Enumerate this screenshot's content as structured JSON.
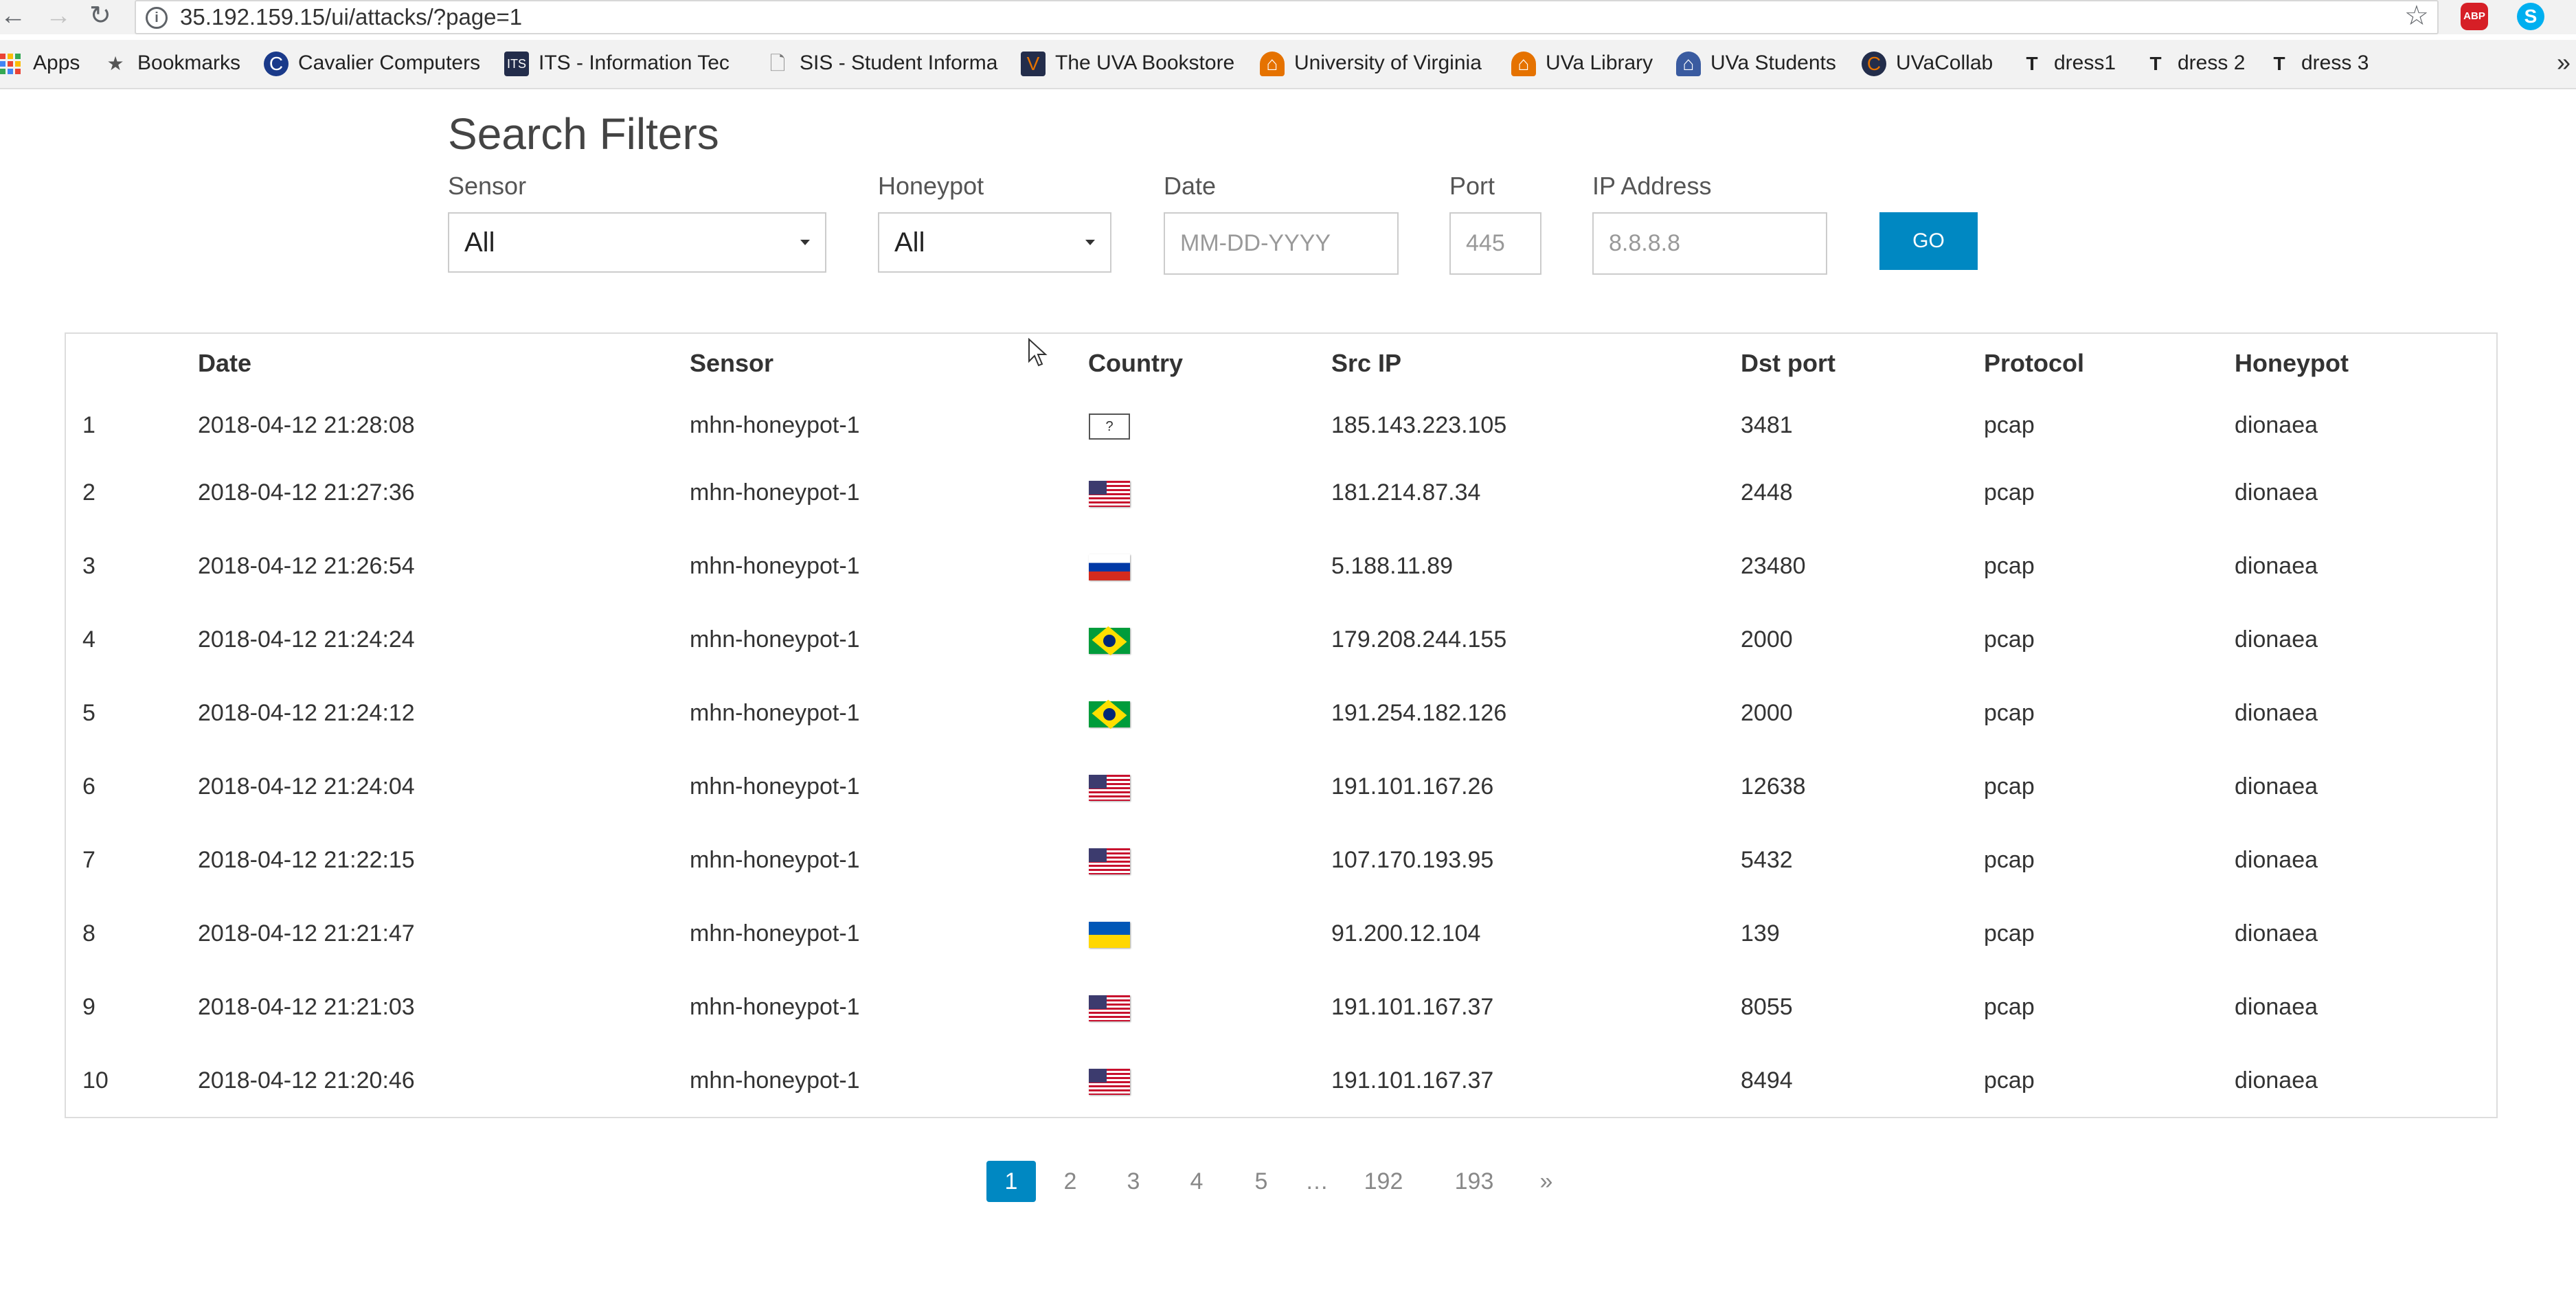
{
  "browser": {
    "url": "35.192.159.15/ui/attacks/?page=1",
    "bookmarks": [
      {
        "label": "Apps",
        "icon": "apps-grid-icon"
      },
      {
        "label": "Bookmarks",
        "icon": "star-icon"
      },
      {
        "label": "Cavalier Computers",
        "icon": "cavalier-icon"
      },
      {
        "label": "ITS - Information Tec",
        "icon": "its-icon"
      },
      {
        "label": "SIS - Student Informa",
        "icon": "page-icon"
      },
      {
        "label": "The UVA Bookstore",
        "icon": "bookstore-icon"
      },
      {
        "label": "University of Virginia",
        "icon": "uva-rotunda-icon"
      },
      {
        "label": "UVa Library",
        "icon": "uva-rotunda-icon"
      },
      {
        "label": "UVa Students",
        "icon": "uva-rotunda-icon"
      },
      {
        "label": "UVaCollab",
        "icon": "collab-icon"
      },
      {
        "label": "dress1",
        "icon": "t-icon"
      },
      {
        "label": "dress 2",
        "icon": "t-icon"
      },
      {
        "label": "dress 3",
        "icon": "t-icon"
      }
    ]
  },
  "filters": {
    "title": "Search Filters",
    "sensor": {
      "label": "Sensor",
      "value": "All"
    },
    "honeypot": {
      "label": "Honeypot",
      "value": "All"
    },
    "date": {
      "label": "Date",
      "placeholder": "MM-DD-YYYY"
    },
    "port": {
      "label": "Port",
      "placeholder": "445"
    },
    "ip": {
      "label": "IP Address",
      "placeholder": "8.8.8.8"
    },
    "go_label": "GO"
  },
  "table": {
    "columns": [
      "Date",
      "Sensor",
      "Country",
      "Src IP",
      "Dst port",
      "Protocol",
      "Honeypot"
    ],
    "rows": [
      {
        "n": "1",
        "date": "2018-04-12 21:28:08",
        "sensor": "mhn-honeypot-1",
        "country": "unknown",
        "country_text": "?",
        "src_ip": "185.143.223.105",
        "dst_port": "3481",
        "protocol": "pcap",
        "honeypot": "dionaea"
      },
      {
        "n": "2",
        "date": "2018-04-12 21:27:36",
        "sensor": "mhn-honeypot-1",
        "country": "us",
        "country_text": "",
        "src_ip": "181.214.87.34",
        "dst_port": "2448",
        "protocol": "pcap",
        "honeypot": "dionaea"
      },
      {
        "n": "3",
        "date": "2018-04-12 21:26:54",
        "sensor": "mhn-honeypot-1",
        "country": "ru",
        "country_text": "",
        "src_ip": "5.188.11.89",
        "dst_port": "23480",
        "protocol": "pcap",
        "honeypot": "dionaea"
      },
      {
        "n": "4",
        "date": "2018-04-12 21:24:24",
        "sensor": "mhn-honeypot-1",
        "country": "br",
        "country_text": "",
        "src_ip": "179.208.244.155",
        "dst_port": "2000",
        "protocol": "pcap",
        "honeypot": "dionaea"
      },
      {
        "n": "5",
        "date": "2018-04-12 21:24:12",
        "sensor": "mhn-honeypot-1",
        "country": "br",
        "country_text": "",
        "src_ip": "191.254.182.126",
        "dst_port": "2000",
        "protocol": "pcap",
        "honeypot": "dionaea"
      },
      {
        "n": "6",
        "date": "2018-04-12 21:24:04",
        "sensor": "mhn-honeypot-1",
        "country": "us",
        "country_text": "",
        "src_ip": "191.101.167.26",
        "dst_port": "12638",
        "protocol": "pcap",
        "honeypot": "dionaea"
      },
      {
        "n": "7",
        "date": "2018-04-12 21:22:15",
        "sensor": "mhn-honeypot-1",
        "country": "us",
        "country_text": "",
        "src_ip": "107.170.193.95",
        "dst_port": "5432",
        "protocol": "pcap",
        "honeypot": "dionaea"
      },
      {
        "n": "8",
        "date": "2018-04-12 21:21:47",
        "sensor": "mhn-honeypot-1",
        "country": "ua",
        "country_text": "",
        "src_ip": "91.200.12.104",
        "dst_port": "139",
        "protocol": "pcap",
        "honeypot": "dionaea"
      },
      {
        "n": "9",
        "date": "2018-04-12 21:21:03",
        "sensor": "mhn-honeypot-1",
        "country": "us",
        "country_text": "",
        "src_ip": "191.101.167.37",
        "dst_port": "8055",
        "protocol": "pcap",
        "honeypot": "dionaea"
      },
      {
        "n": "10",
        "date": "2018-04-12 21:20:46",
        "sensor": "mhn-honeypot-1",
        "country": "us",
        "country_text": "",
        "src_ip": "191.101.167.37",
        "dst_port": "8494",
        "protocol": "pcap",
        "honeypot": "dionaea"
      }
    ]
  },
  "pagination": {
    "pages": [
      "1",
      "2",
      "3",
      "4",
      "5",
      "…",
      "192",
      "193",
      "»"
    ],
    "current": "1"
  },
  "colors": {
    "accent": "#0088c2"
  }
}
